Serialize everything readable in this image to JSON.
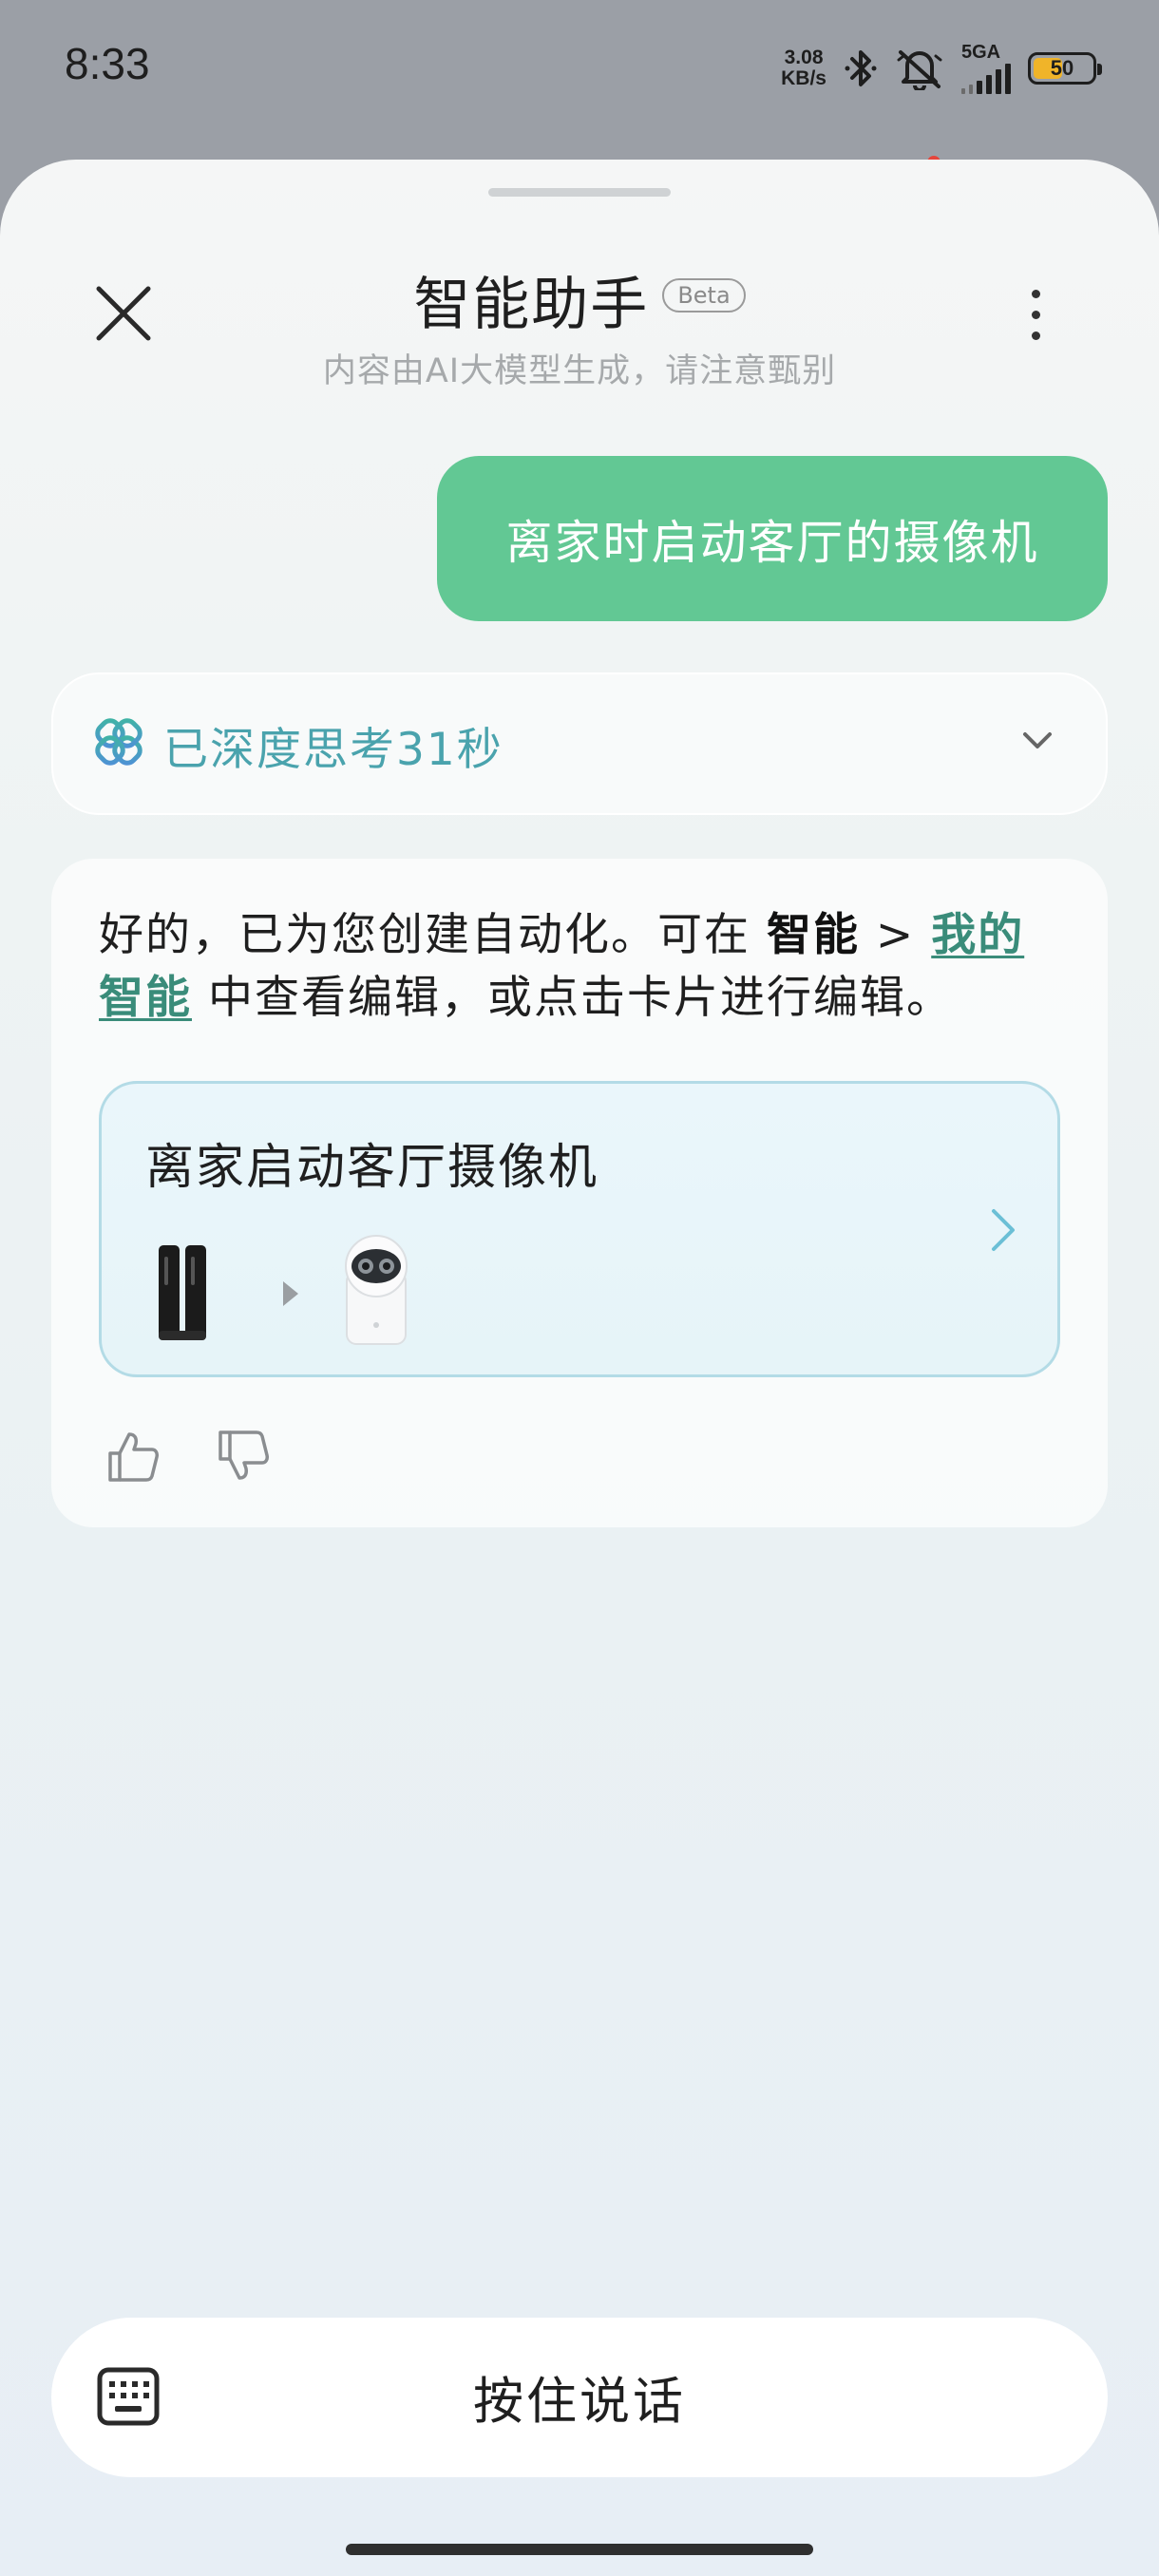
{
  "status_bar": {
    "time": "8:33",
    "net_speed_value": "3.08",
    "net_speed_unit": "KB/s",
    "network_type": "5GA",
    "battery_level": 50,
    "battery_text": "50",
    "icons": [
      "bluetooth-icon",
      "mute-icon",
      "signal-icon",
      "battery-icon"
    ]
  },
  "header": {
    "title": "智能助手",
    "badge": "Beta",
    "subtitle": "内容由AI大模型生成，请注意甄别",
    "close_icon": "close-icon",
    "more_icon": "more-vertical-icon"
  },
  "conversation": {
    "user_message": "离家时启动客厅的摄像机",
    "thinking": {
      "label": "已深度思考31秒",
      "icon": "deep-think-icon",
      "expand_icon": "chevron-down-icon"
    },
    "reply": {
      "text_before": "好的，已为您创建自动化。可在 ",
      "bold_path": "智能",
      "separator": " > ",
      "link_text": "我的智能",
      "text_after": " 中查看编辑，或点击卡片进行编辑。"
    },
    "automation_card": {
      "title": "离家启动客厅摄像机",
      "trigger_device": "smart-lock-icon",
      "action_device": "camera-icon",
      "open_icon": "chevron-right-icon"
    },
    "feedback": {
      "like_icon": "thumb-up-icon",
      "dislike_icon": "thumb-down-icon"
    }
  },
  "input_bar": {
    "keyboard_icon": "keyboard-icon",
    "voice_label": "按住说话"
  },
  "colors": {
    "accent_green": "#62c894",
    "thinking_teal": "#4aa3ad",
    "link_green": "#3a8c7a",
    "card_border": "#b3dbe6",
    "notification_red": "#e5453b",
    "battery_yellow": "#f0b429"
  }
}
